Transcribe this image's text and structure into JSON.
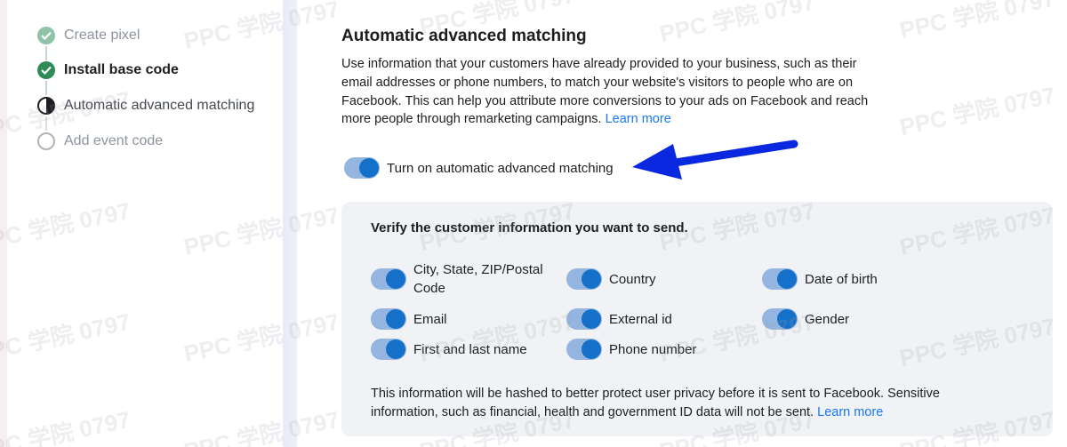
{
  "steps": [
    {
      "label": "Create pixel",
      "status": "completed"
    },
    {
      "label": "Install base code",
      "status": "completed"
    },
    {
      "label": "Automatic advanced matching",
      "status": "in-progress"
    },
    {
      "label": "Add event code",
      "status": "pending"
    }
  ],
  "section": {
    "title": "Automatic advanced matching",
    "description": "Use information that your customers have already provided to your business, such as their email addresses or phone numbers, to match your website's visitors to people who are on Facebook. This can help you attribute more conversions to your ads on Facebook and reach more people through remarketing campaigns. ",
    "learn_more": "Learn more"
  },
  "main_toggle": {
    "label": "Turn on automatic advanced matching",
    "state": "on"
  },
  "verify": {
    "title": "Verify the customer information you want to send.",
    "fields": [
      {
        "label": "City, State, ZIP/Postal Code",
        "state": "on"
      },
      {
        "label": "Country",
        "state": "on"
      },
      {
        "label": "Date of birth",
        "state": "on"
      },
      {
        "label": "Email",
        "state": "on"
      },
      {
        "label": "External id",
        "state": "on"
      },
      {
        "label": "Gender",
        "state": "on"
      },
      {
        "label": "First and last name",
        "state": "on"
      },
      {
        "label": "Phone number",
        "state": "on"
      }
    ],
    "note": "This information will be hashed to better protect user privacy before it is sent to Facebook. Sensitive information, such as financial, health and government ID data will not be sent. ",
    "learn_more": "Learn more"
  },
  "watermark": "PPC 学院 0797",
  "colors": {
    "accent": "#1877f2",
    "toggle_knob": "#1470c8",
    "toggle_track": "#93b5df",
    "complete_step": "#2e8b57",
    "arrow": "#0a28e0"
  }
}
